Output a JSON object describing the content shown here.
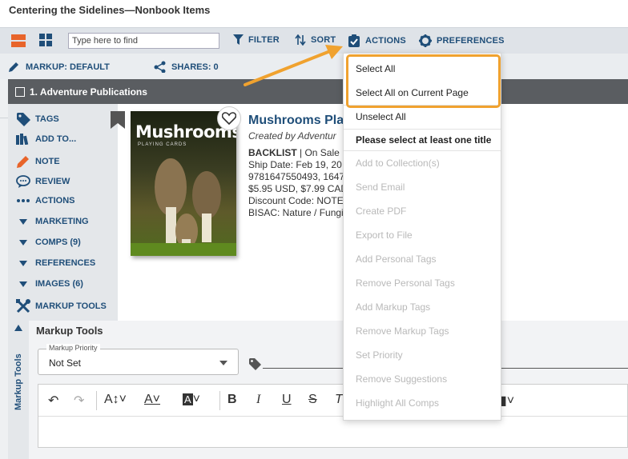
{
  "page": {
    "title": "Centering the Sidelines—Nonbook Items"
  },
  "toolbar": {
    "search_placeholder": "Type here to find",
    "filter": "FILTER",
    "sort": "SORT",
    "actions": "ACTIONS",
    "preferences": "PREFERENCES"
  },
  "subbar": {
    "markup": "MARKUP: DEFAULT",
    "shares": "SHARES: 0"
  },
  "row": {
    "title": "1. Adventure Publications"
  },
  "sidebar": {
    "items": [
      {
        "label": "TAGS",
        "icon": "tag-icon"
      },
      {
        "label": "ADD TO...",
        "icon": "books-icon"
      },
      {
        "label": "NOTE",
        "icon": "pencil-icon"
      },
      {
        "label": "REVIEW",
        "icon": "speech-bubble-icon"
      },
      {
        "label": "ACTIONS",
        "icon": "more-dots-icon"
      },
      {
        "label": "MARKETING",
        "icon": "triangle-down-icon"
      },
      {
        "label": "COMPS (9)",
        "icon": "triangle-down-icon"
      },
      {
        "label": "REFERENCES",
        "icon": "triangle-down-icon"
      },
      {
        "label": "IMAGES (6)",
        "icon": "triangle-down-icon"
      },
      {
        "label": "MARKUP TOOLS",
        "icon": "tools-icon"
      }
    ]
  },
  "book": {
    "cover_title": "Mushrooms",
    "cover_subtitle": "PLAYING CARDS",
    "title": "Mushrooms Play",
    "author": "Created by Adventur",
    "status_label": "BACKLIST",
    "status_rest": " | On Sale D",
    "ship_date": "Ship Date: Feb 19, 20",
    "isbn": "9781647550493, 1647",
    "price": "$5.95 USD, $7.99 CAD",
    "discount": "Discount Code: NOTE",
    "bisac": "BISAC: Nature / Fungi"
  },
  "markup_tools": {
    "vertical_label": "Markup Tools",
    "title": "Markup Tools",
    "priority_label": "Markup Priority",
    "priority_value": "Not Set"
  },
  "actions_menu": {
    "items": [
      {
        "label": "Select All",
        "enabled": true
      },
      {
        "label": "Select All on Current Page",
        "enabled": true
      },
      {
        "label": "Unselect All",
        "enabled": true
      },
      {
        "label": "Please select at least one title",
        "enabled": true,
        "bold": true
      },
      {
        "label": "Add to Collection(s)",
        "enabled": false
      },
      {
        "label": "Send Email",
        "enabled": false
      },
      {
        "label": "Create PDF",
        "enabled": false
      },
      {
        "label": "Export to File",
        "enabled": false
      },
      {
        "label": "Add Personal Tags",
        "enabled": false
      },
      {
        "label": "Remove Personal Tags",
        "enabled": false
      },
      {
        "label": "Add Markup Tags",
        "enabled": false
      },
      {
        "label": "Remove Markup Tags",
        "enabled": false
      },
      {
        "label": "Set Priority",
        "enabled": false
      },
      {
        "label": "Remove Suggestions",
        "enabled": false
      },
      {
        "label": "Highlight All Comps",
        "enabled": false
      }
    ]
  },
  "colors": {
    "accent_orange": "#f0a22f",
    "brand_blue": "#1f4e79",
    "header_gray": "#5a5d61"
  }
}
